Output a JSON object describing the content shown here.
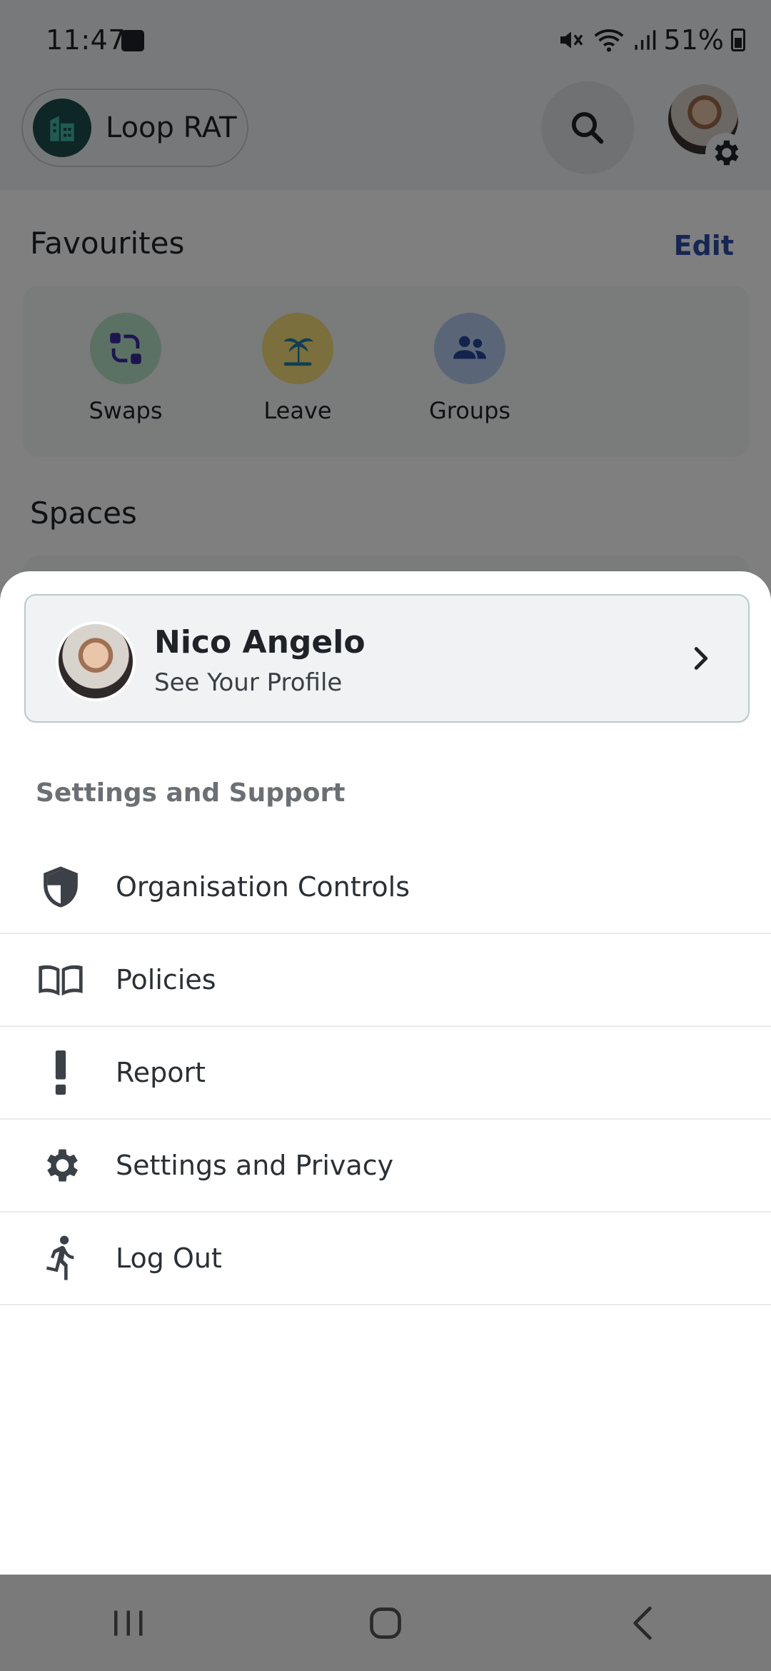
{
  "status_bar": {
    "time": "11:47",
    "battery": "51%"
  },
  "header": {
    "org_name": "Loop RAT"
  },
  "favourites": {
    "title": "Favourites",
    "edit_label": "Edit",
    "items": [
      {
        "label": "Swaps",
        "icon": "swap-icon",
        "color": "#b7e3c9"
      },
      {
        "label": "Leave",
        "icon": "palm-tree-icon",
        "color": "#f4df7a"
      },
      {
        "label": "Groups",
        "icon": "groups-icon",
        "color": "#b4cdf0"
      }
    ]
  },
  "spaces": {
    "title": "Spaces"
  },
  "sheet": {
    "profile": {
      "name": "Nico Angelo",
      "subtitle": "See Your Profile"
    },
    "section_title": "Settings and Support",
    "menu": [
      {
        "label": "Organisation Controls",
        "icon": "shield-icon"
      },
      {
        "label": "Policies",
        "icon": "book-icon"
      },
      {
        "label": "Report",
        "icon": "exclamation-icon"
      },
      {
        "label": "Settings and Privacy",
        "icon": "gear-icon"
      },
      {
        "label": "Log Out",
        "icon": "running-person-icon"
      }
    ]
  },
  "colors": {
    "accent": "#2e4ea8",
    "org_avatar": "#1d4d4d",
    "icon_dark": "#3c4147"
  }
}
